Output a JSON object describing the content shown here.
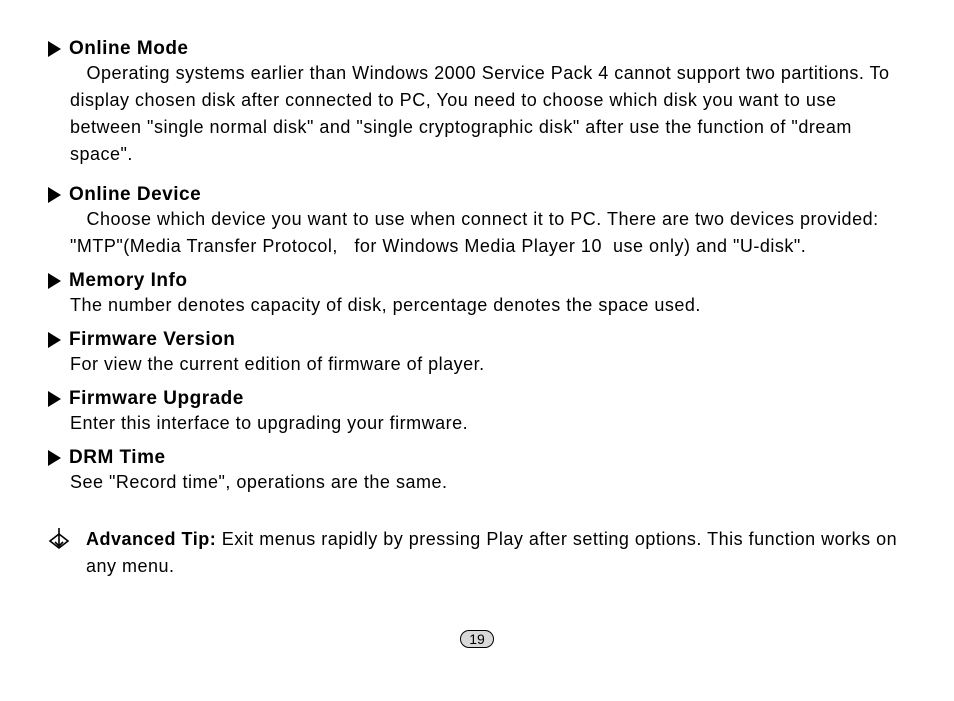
{
  "sections": [
    {
      "title": "Online Mode",
      "body": "   Operating systems earlier than Windows 2000 Service Pack 4 cannot support two partitions. To display chosen disk after connected to PC, You need to choose which disk you want to use between \"single normal disk\" and \"single cryptographic disk\" after use the function of \"dream space\"."
    },
    {
      "title": "Online Device",
      "body": "   Choose which device you want to use when connect it to PC. There are two devices provided: \"MTP\"(Media Transfer Protocol,   for Windows Media Player 10  use only) and \"U-disk\"."
    },
    {
      "title": "Memory Info",
      "body": "The number denotes capacity of disk, percentage denotes the space used."
    },
    {
      "title": "Firmware Version",
      "body": "For view the current edition of firmware of player."
    },
    {
      "title": "Firmware Upgrade",
      "body": "Enter this interface to upgrading your firmware."
    },
    {
      "title": "DRM Time",
      "body": "See \"Record time\", operations are the same."
    }
  ],
  "tip": {
    "label": "Advanced Tip:",
    "body": " Exit menus rapidly by pressing Play after setting options. This function works on any menu."
  },
  "page_number": "19"
}
